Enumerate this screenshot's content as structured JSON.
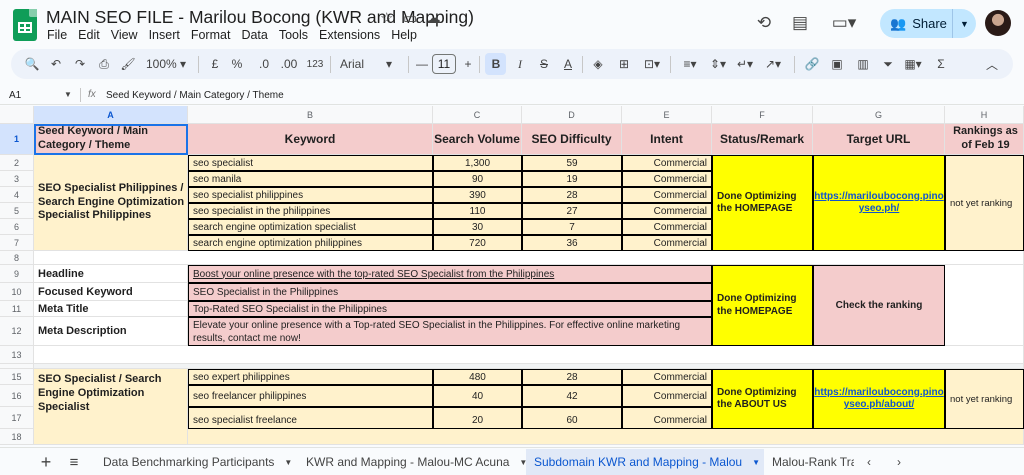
{
  "app": {
    "title": "MAIN SEO FILE - Marilou Bocong (KWR and Mapping)"
  },
  "menu": [
    "File",
    "Edit",
    "View",
    "Insert",
    "Format",
    "Data",
    "Tools",
    "Extensions",
    "Help"
  ],
  "share": {
    "label": "Share"
  },
  "toolbar": {
    "zoom": "100%",
    "currency": "£",
    "percent": "%",
    "dec_less": ".0",
    "dec_more": ".00",
    "format123": "123",
    "font": "Arial",
    "font_size": "11",
    "minus": "—",
    "plus": "+",
    "bold": "B",
    "italic": "I",
    "strike": "S",
    "textcolor": "A",
    "sigma": "Σ"
  },
  "formula_bar": {
    "cell": "A1",
    "fx": "fx",
    "content": "Seed Keyword  / Main Category / Theme"
  },
  "columns": [
    "A",
    "B",
    "C",
    "D",
    "E",
    "F",
    "G",
    "H"
  ],
  "rows": [
    "1",
    "2",
    "3",
    "4",
    "5",
    "6",
    "7",
    "8",
    "9",
    "10",
    "11",
    "12",
    "13",
    "15",
    "16",
    "17",
    "18"
  ],
  "header_row": {
    "a": "Seed Keyword  / Main Category / Theme",
    "b": "Keyword",
    "c": "Search Volume",
    "d": "SEO Difficulty",
    "e": "Intent",
    "f": "Status/Remark",
    "g": "Target URL",
    "h": "Rankings as of Feb 19"
  },
  "group1": {
    "theme": "SEO Specialist Philippines / Search Engine Optimization Specialist Philippines",
    "rows": [
      {
        "keyword": "seo specialist",
        "volume": "1,300",
        "difficulty": "59",
        "intent": "Commercial"
      },
      {
        "keyword": "seo manila",
        "volume": "90",
        "difficulty": "19",
        "intent": "Commercial"
      },
      {
        "keyword": "seo specialist philippines",
        "volume": "390",
        "difficulty": "28",
        "intent": "Commercial"
      },
      {
        "keyword": "seo specialist in the philippines",
        "volume": "110",
        "difficulty": "27",
        "intent": "Commercial"
      },
      {
        "keyword": "search engine optimization specialist",
        "volume": "30",
        "difficulty": "7",
        "intent": "Commercial"
      },
      {
        "keyword": "search engine optimization philippines",
        "volume": "720",
        "difficulty": "36",
        "intent": "Commercial"
      }
    ],
    "status": "Done Optimizing the HOMEPAGE",
    "url": "https://mariloubocong.pinoyseo.ph/",
    "ranking": "not yet ranking"
  },
  "meta": {
    "headline_label": "Headline",
    "headline": "Boost your online presence with the top-rated SEO Specialist from the Philippines",
    "focus_label": "Focused Keyword",
    "focus": "SEO Specialist in the Philippines",
    "title_label": "Meta Title",
    "title": "Top-Rated SEO Specialist in the Philippines",
    "desc_label": "Meta Description",
    "desc": "Elevate your online presence with a Top-rated SEO Specialist in the Philippines. For effective online marketing results, contact me now!",
    "status": "Done Optimizing the HOMEPAGE",
    "check": "Check the ranking"
  },
  "group2": {
    "theme": "SEO Specialist / Search Engine Optimization Specialist",
    "rows": [
      {
        "keyword": "seo expert philippines",
        "volume": "480",
        "difficulty": "28",
        "intent": "Commercial"
      },
      {
        "keyword": "seo freelancer philippines",
        "volume": "40",
        "difficulty": "42",
        "intent": "Commercial"
      },
      {
        "keyword": "seo specialist freelance",
        "volume": "20",
        "difficulty": "60",
        "intent": "Commercial"
      }
    ],
    "status": "Done Optimizing the ABOUT US",
    "url": "https://mariloubocong.pinoyseo.ph/about/",
    "ranking": "not yet ranking"
  },
  "tabs": [
    "Data Benchmarking Participants",
    "KWR and Mapping - Malou-MC Acuna",
    "Subdomain KWR and Mapping - Malou",
    "Malou-Rank Tra"
  ],
  "colors": {
    "header_pink": "#f4cccc",
    "tan": "#fff2cc",
    "yellow": "#ffff00",
    "link": "#1155cc",
    "active_tab": "#0b57d0"
  }
}
